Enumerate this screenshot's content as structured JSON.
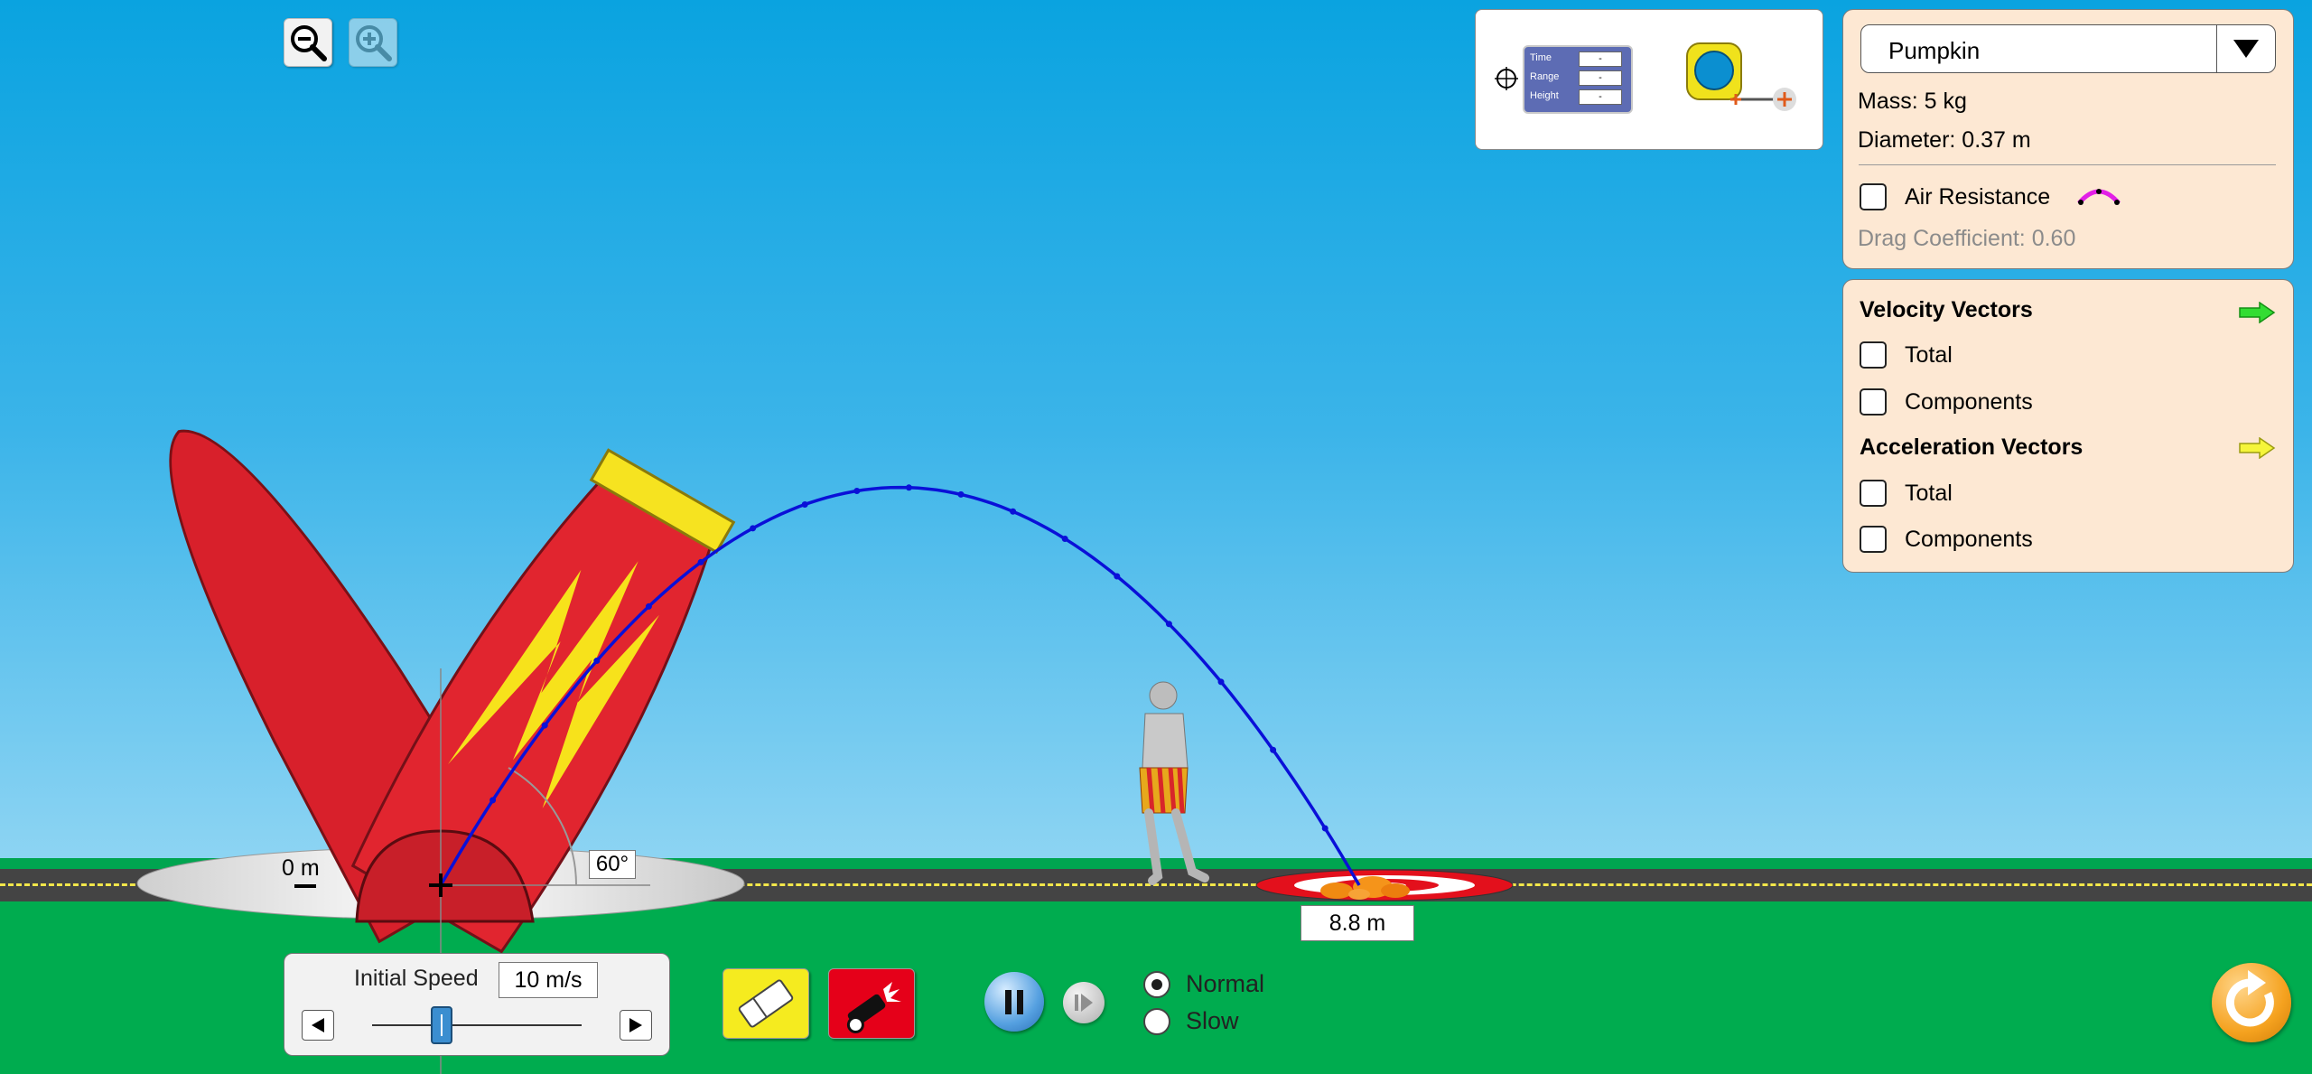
{
  "zoom_controls": {
    "zoom_out_icon": "magnifier-minus-icon",
    "zoom_in_icon": "magnifier-plus-icon"
  },
  "toolbox": {
    "stopwatch": {
      "rows": [
        {
          "label": "Time",
          "value": "-"
        },
        {
          "label": "Range",
          "value": "-"
        },
        {
          "label": "Height",
          "value": "-"
        }
      ]
    },
    "tape_measure_icon": "tape-measure-icon"
  },
  "projectile_panel": {
    "selected_object": "Pumpkin",
    "mass": "Mass: 5 kg",
    "diameter": "Diameter: 0.37 m",
    "air_resistance_label": "Air Resistance",
    "air_resistance_checked": false,
    "drag_coefficient": "Drag Coefficient: 0.60"
  },
  "vectors_panel": {
    "velocity_title": "Velocity Vectors",
    "velocity_color": "#33dd33",
    "velocity_options": [
      {
        "label": "Total",
        "checked": false
      },
      {
        "label": "Components",
        "checked": false
      }
    ],
    "acceleration_title": "Acceleration Vectors",
    "acceleration_color": "#f5f53a",
    "acceleration_options": [
      {
        "label": "Total",
        "checked": false
      },
      {
        "label": "Components",
        "checked": false
      }
    ]
  },
  "scene": {
    "height_label": "0 m",
    "angle_label": "60°",
    "range_label": "8.8 m",
    "initial_speed_value": 10,
    "cannon_angle_deg": 60,
    "trajectory_color": "#0a10d8"
  },
  "speed_control": {
    "label": "Initial Speed",
    "value": "10 m/s",
    "slider_fraction": 0.33
  },
  "buttons": {
    "eraser_icon": "eraser-icon",
    "fire_icon": "cannon-fire-icon",
    "pause_icon": "pause-icon",
    "step_icon": "step-forward-icon",
    "reset_icon": "reset-icon"
  },
  "sim_speed": {
    "options": [
      {
        "label": "Normal",
        "selected": true
      },
      {
        "label": "Slow",
        "selected": false
      }
    ]
  }
}
